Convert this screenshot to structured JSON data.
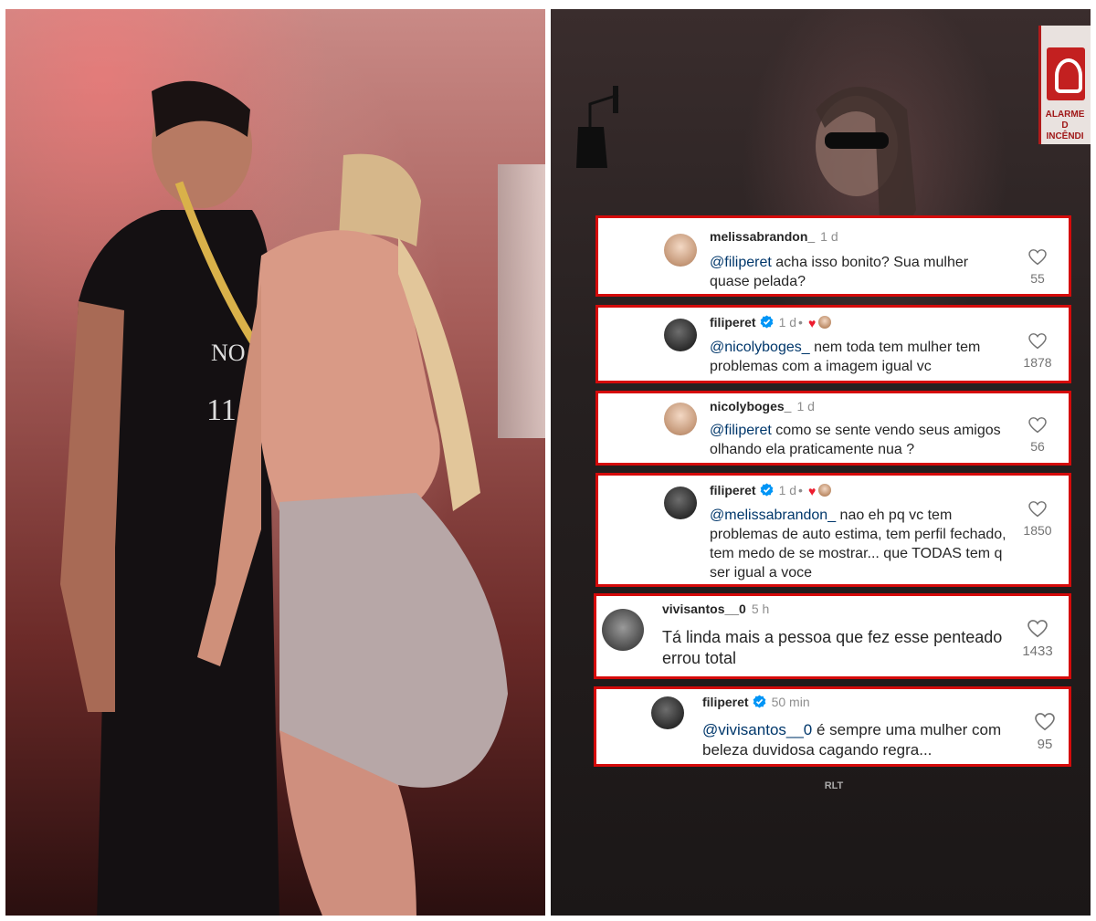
{
  "sign": {
    "line1": "ALARME D",
    "line2": "INCÊNDI"
  },
  "watermark": "RLT",
  "comments": [
    {
      "user": "melissabrandon_",
      "time": "1 d",
      "mention": "@filiperet",
      "text": " acha isso bonito? Sua mulher quase pelada?",
      "likes": "55",
      "verified": false,
      "author_liked": false
    },
    {
      "user": "filiperet",
      "time": "1 d",
      "mention": "@nicolyboges_",
      "text": " nem toda tem mulher tem problemas com a imagem igual vc",
      "likes": "1878",
      "verified": true,
      "author_liked": true
    },
    {
      "user": "nicolyboges_",
      "time": "1 d",
      "mention": "@filiperet",
      "text": " como se sente vendo seus amigos olhando ela praticamente nua ?",
      "likes": "56",
      "verified": false,
      "author_liked": false
    },
    {
      "user": "filiperet",
      "time": "1 d",
      "mention": "@melissabrandon_",
      "text": " nao eh pq vc tem problemas de auto estima, tem perfil fechado, tem medo de se mostrar... que TODAS tem q ser igual a voce",
      "likes": "1850",
      "verified": true,
      "author_liked": true
    },
    {
      "user": "vivisantos__0",
      "time": "5 h",
      "mention": "",
      "text": "Tá linda mais  a pessoa que fez esse penteado errou total",
      "likes": "1433",
      "verified": false,
      "author_liked": false
    },
    {
      "user": "filiperet",
      "time": "50 min",
      "mention": "@vivisantos__0",
      "text": " é sempre uma mulher com beleza duvidosa cagando regra...",
      "likes": "95",
      "verified": true,
      "author_liked": false
    }
  ],
  "colors": {
    "highlight_border": "#d50a0a",
    "mention": "#00376b",
    "verified": "#0095f6",
    "heart": "#ed1c2e"
  }
}
